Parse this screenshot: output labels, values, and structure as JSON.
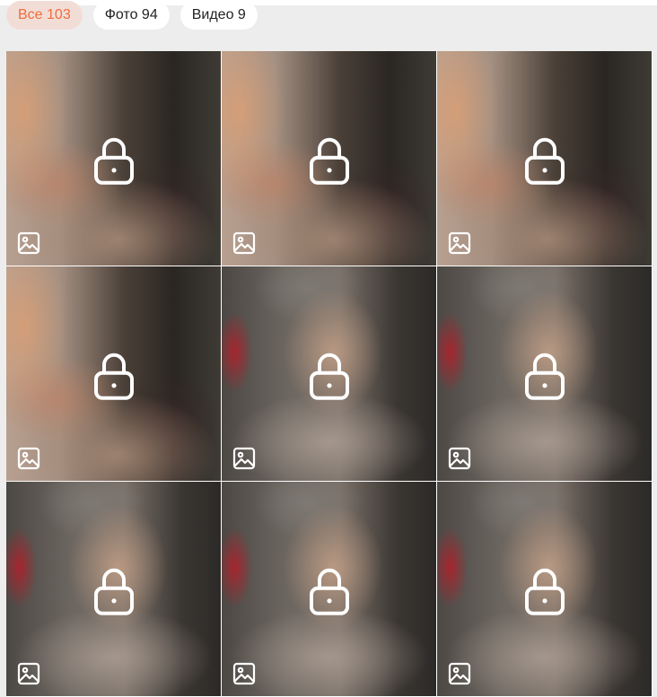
{
  "tabs": [
    {
      "label": "Все 103",
      "active": true
    },
    {
      "label": "Фото 94",
      "active": false
    },
    {
      "label": "Видео 9",
      "active": false
    }
  ],
  "colors": {
    "accent": "#ee6d3a",
    "accent_bg": "#f2ddd6",
    "panel_bg": "#ededed"
  },
  "grid": {
    "columns": 3,
    "items": [
      {
        "locked": true,
        "media_icon": "image-icon",
        "lock_icon": "lock-icon"
      },
      {
        "locked": true,
        "media_icon": "image-icon",
        "lock_icon": "lock-icon"
      },
      {
        "locked": true,
        "media_icon": "image-icon",
        "lock_icon": "lock-icon"
      },
      {
        "locked": true,
        "media_icon": "image-icon",
        "lock_icon": "lock-icon"
      },
      {
        "locked": true,
        "media_icon": "image-icon",
        "lock_icon": "lock-icon"
      },
      {
        "locked": true,
        "media_icon": "image-icon",
        "lock_icon": "lock-icon"
      },
      {
        "locked": true,
        "media_icon": "image-icon",
        "lock_icon": "lock-icon"
      },
      {
        "locked": true,
        "media_icon": "image-icon",
        "lock_icon": "lock-icon"
      },
      {
        "locked": true,
        "media_icon": "image-icon",
        "lock_icon": "lock-icon"
      }
    ]
  }
}
